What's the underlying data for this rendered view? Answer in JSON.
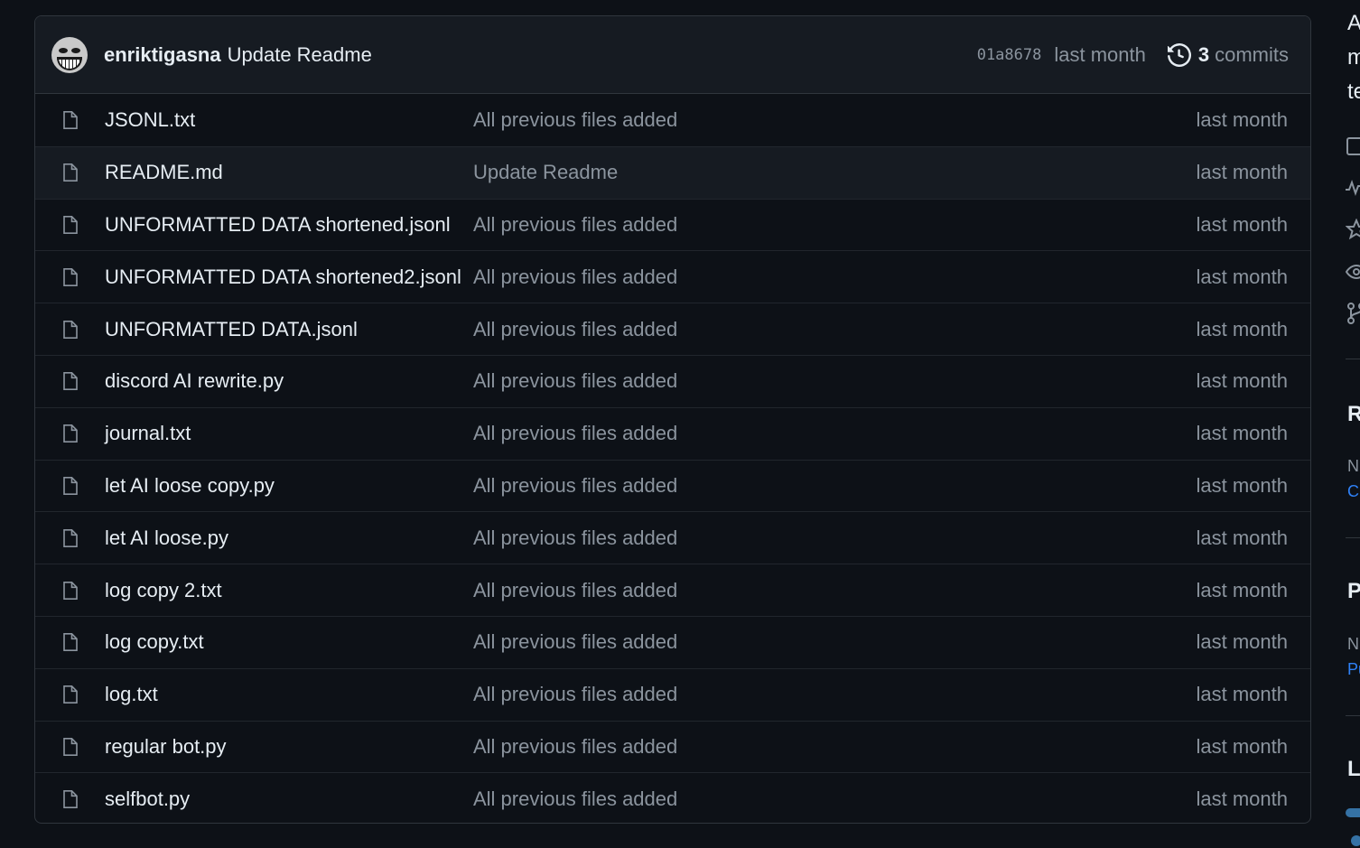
{
  "commit": {
    "author": "enriktigasna",
    "message": "Update Readme",
    "sha": "01a8678",
    "time": "last month",
    "commits_count": "3",
    "commits_label": "commits"
  },
  "files": [
    {
      "name": "JSONL.txt",
      "message": "All previous files added",
      "time": "last month"
    },
    {
      "name": "README.md",
      "message": "Update Readme",
      "time": "last month"
    },
    {
      "name": "UNFORMATTED DATA shortened.jsonl",
      "message": "All previous files added",
      "time": "last month"
    },
    {
      "name": "UNFORMATTED DATA shortened2.jsonl",
      "message": "All previous files added",
      "time": "last month"
    },
    {
      "name": "UNFORMATTED DATA.jsonl",
      "message": "All previous files added",
      "time": "last month"
    },
    {
      "name": "discord AI rewrite.py",
      "message": "All previous files added",
      "time": "last month"
    },
    {
      "name": "journal.txt",
      "message": "All previous files added",
      "time": "last month"
    },
    {
      "name": "let AI loose copy.py",
      "message": "All previous files added",
      "time": "last month"
    },
    {
      "name": "let AI loose.py",
      "message": "All previous files added",
      "time": "last month"
    },
    {
      "name": "log copy 2.txt",
      "message": "All previous files added",
      "time": "last month"
    },
    {
      "name": "log copy.txt",
      "message": "All previous files added",
      "time": "last month"
    },
    {
      "name": "log.txt",
      "message": "All previous files added",
      "time": "last month"
    },
    {
      "name": "regular bot.py",
      "message": "All previous files added",
      "time": "last month"
    },
    {
      "name": "selfbot.py",
      "message": "All previous files added",
      "time": "last month"
    }
  ],
  "sidebar": {
    "about_line1": "A",
    "about_line2": "m",
    "about_line3": "te",
    "releases_heading": "R",
    "releases_none": "N",
    "releases_link": "Cr",
    "packages_heading": "P",
    "packages_none": "N",
    "packages_link": "Pu",
    "languages_heading": "La"
  },
  "colors": {
    "background": "#0d1117",
    "header_bg": "#161b22",
    "border": "#30363d",
    "muted_text": "#8b949e",
    "link": "#2f81f7",
    "python": "#3572a5"
  }
}
